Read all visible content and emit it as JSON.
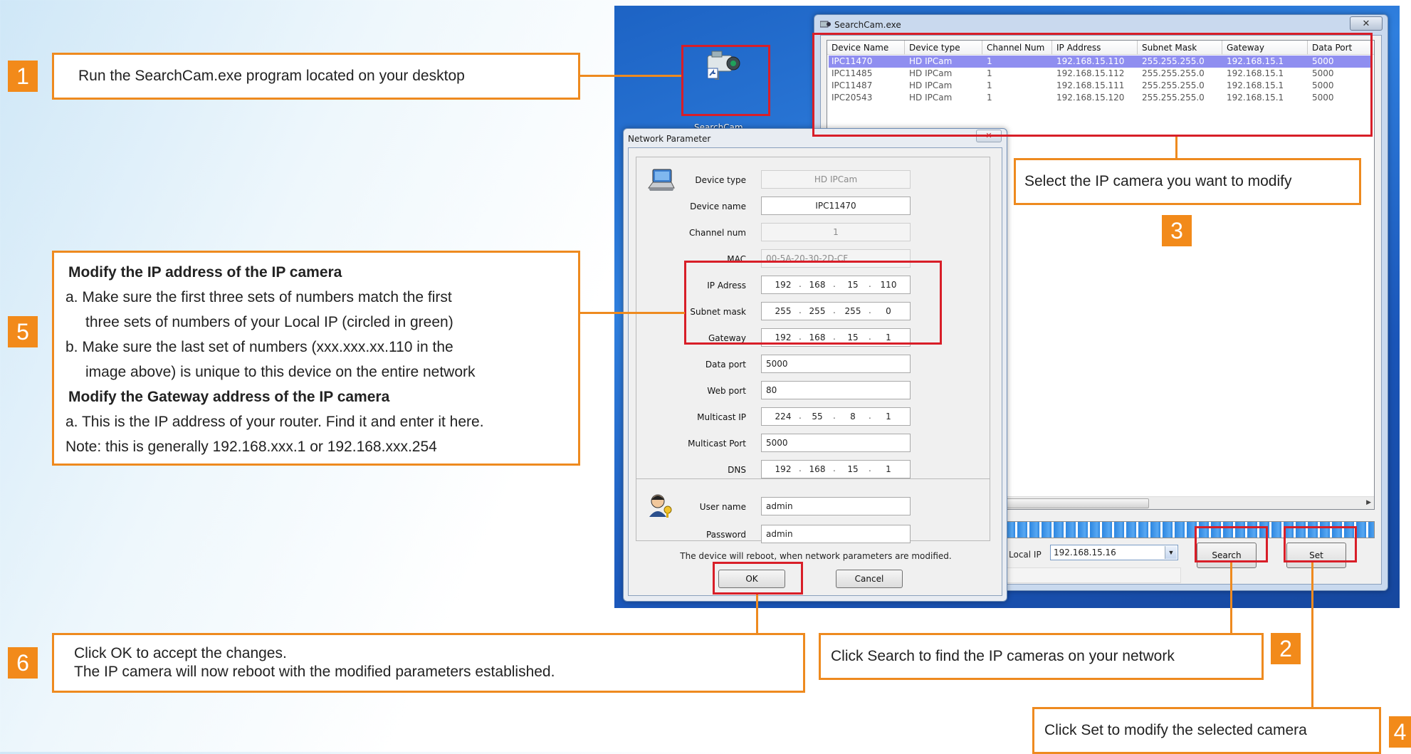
{
  "steps": {
    "s1": {
      "num": "1",
      "text": "Run the SearchCam.exe program located on your desktop"
    },
    "s2": {
      "num": "2",
      "text": "Click Search to find the IP cameras on your network"
    },
    "s3": {
      "num": "3",
      "text": "Select the IP camera you want to modify"
    },
    "s4": {
      "num": "4",
      "text": "Click Set to modify the selected camera"
    },
    "s5": {
      "num": "5",
      "heading1": "Modify the IP address of the IP camera",
      "a1": "a. Make sure the first three sets of numbers match the first",
      "a2": "three sets of numbers of your Local IP (circled in green)",
      "b1": "b. Make sure the last set of numbers (xxx.xxx.xx.110 in the",
      "b2": "image above) is unique to this device on the entire network",
      "heading2": "Modify the Gateway address of the IP camera",
      "c1": "a. This is the IP address of your router. Find it and enter it here.",
      "note": "Note: this is generally 192.168.xxx.1 or 192.168.xxx.254"
    },
    "s6": {
      "num": "6",
      "line1": "Click OK to accept the changes.",
      "line2": "The IP camera will now reboot with the modified parameters established."
    }
  },
  "desktop": {
    "icon_label": "SearchCam..."
  },
  "searchcam": {
    "title": "SearchCam.exe",
    "columns": [
      "Device Name",
      "Device type",
      "Channel Num",
      "IP Address",
      "Subnet Mask",
      "Gateway",
      "Data Port"
    ],
    "rows": [
      [
        "IPC11470",
        "HD IPCam",
        "1",
        "192.168.15.110",
        "255.255.255.0",
        "192.168.15.1",
        "5000"
      ],
      [
        "IPC11485",
        "HD IPCam",
        "1",
        "192.168.15.112",
        "255.255.255.0",
        "192.168.15.1",
        "5000"
      ],
      [
        "IPC11487",
        "HD IPCam",
        "1",
        "192.168.15.111",
        "255.255.255.0",
        "192.168.15.1",
        "5000"
      ],
      [
        "IPC20543",
        "HD IPCam",
        "1",
        "192.168.15.120",
        "255.255.255.0",
        "192.168.15.1",
        "5000"
      ]
    ],
    "local_ip_label": "Local IP",
    "local_ip_value": "192.168.15.16",
    "search_label": "Search",
    "set_label": "Set"
  },
  "netparam": {
    "title": "Network Parameter",
    "device_type_label": "Device type",
    "device_type": "HD IPCam",
    "device_name_label": "Device name",
    "device_name": "IPC11470",
    "channel_label": "Channel num",
    "channel": "1",
    "mac_label": "MAC",
    "mac": "00-5A-20-30-2D-CF",
    "ip_label": "IP Adress",
    "ip": [
      "192",
      "168",
      "15",
      "110"
    ],
    "mask_label": "Subnet mask",
    "mask": [
      "255",
      "255",
      "255",
      "0"
    ],
    "gateway_label": "Gateway",
    "gateway": [
      "192",
      "168",
      "15",
      "1"
    ],
    "data_port_label": "Data port",
    "data_port": "5000",
    "web_port_label": "Web port",
    "web_port": "80",
    "multicast_ip_label": "Multicast IP",
    "multicast_ip": [
      "224",
      "55",
      "8",
      "1"
    ],
    "multicast_port_label": "Multicast  Port",
    "multicast_port": "5000",
    "dns_label": "DNS",
    "dns": [
      "192",
      "168",
      "15",
      "1"
    ],
    "user_label": "User name",
    "user": "admin",
    "password_label": "Password",
    "password": "admin",
    "notice": "The device will reboot, when network parameters are modified.",
    "ok_label": "OK",
    "cancel_label": "Cancel"
  },
  "colors": {
    "callout_orange": "#ee8a1f",
    "highlight_red": "#d81e28",
    "selected_row": "#8f8ef0",
    "desktop_blue": "#1d63c4"
  }
}
